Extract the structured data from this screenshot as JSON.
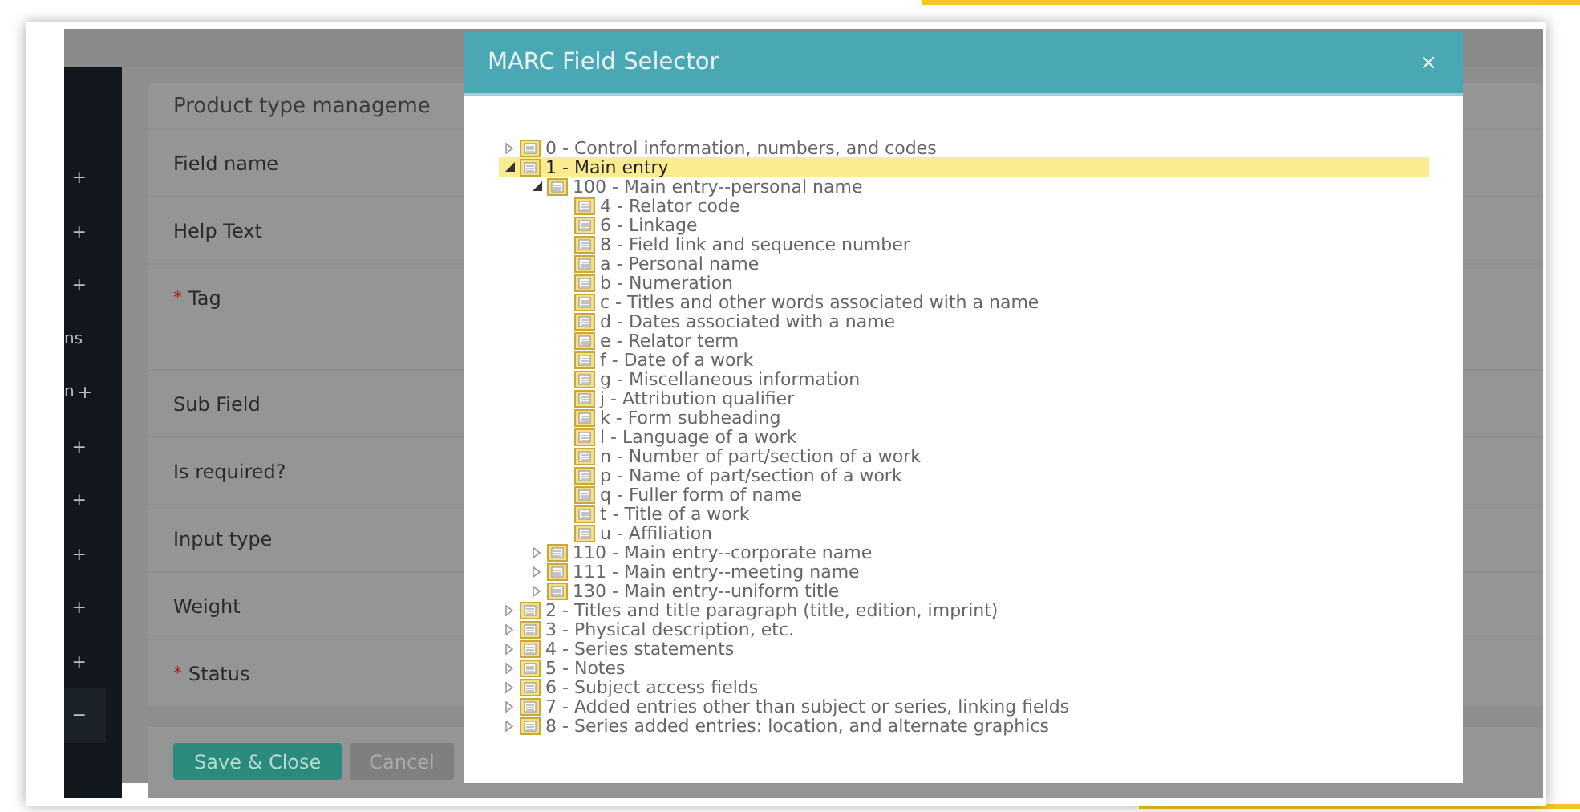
{
  "sidebar": {
    "items": [
      {
        "toggle": "+",
        "selected": false
      },
      {
        "toggle": "+",
        "selected": false
      },
      {
        "toggle": "+",
        "selected": false
      },
      {
        "label": "ns",
        "selected": false
      },
      {
        "label": "n",
        "toggle": "+",
        "selected": false
      },
      {
        "toggle": "+",
        "selected": false
      },
      {
        "toggle": "+",
        "selected": false
      },
      {
        "toggle": "+",
        "selected": false
      },
      {
        "toggle": "+",
        "selected": false
      },
      {
        "toggle": "+",
        "selected": false
      },
      {
        "toggle": "−",
        "selected": true
      }
    ]
  },
  "form": {
    "title": "Product type manageme",
    "fields": [
      {
        "label": "Field name",
        "tall": false
      },
      {
        "label": "Help Text",
        "tall": false
      },
      {
        "marker": "*",
        "label": "Tag",
        "tall": true
      },
      {
        "label": "Sub Field",
        "tall": false
      },
      {
        "label": "Is required?",
        "tall": false
      },
      {
        "label": "Input type",
        "tall": false
      },
      {
        "label": "Weight",
        "tall": false
      },
      {
        "marker": "*",
        "label": "Status",
        "tall": false
      }
    ],
    "buttons": [
      {
        "label": "Save & Close",
        "kind": "primary"
      },
      {
        "label": "Cancel",
        "kind": "secondary"
      }
    ]
  },
  "dialog": {
    "title": "MARC Field Selector",
    "close": "×",
    "tree": [
      {
        "label": "0 - Control information, numbers, and codes",
        "kind": "branch",
        "expanded": false,
        "selected": false
      },
      {
        "label": "1 - Main entry",
        "kind": "branch",
        "expanded": true,
        "selected": true,
        "children": [
          {
            "label": "100 - Main entry--personal name",
            "kind": "branch",
            "expanded": true,
            "selected": false,
            "children": [
              {
                "label": "4 - Relator code",
                "kind": "leaf",
                "selected": false
              },
              {
                "label": "6 - Linkage",
                "kind": "leaf",
                "selected": false
              },
              {
                "label": "8 - Field link and sequence number",
                "kind": "leaf",
                "selected": false
              },
              {
                "label": "a - Personal name",
                "kind": "leaf",
                "selected": false
              },
              {
                "label": "b - Numeration",
                "kind": "leaf",
                "selected": false
              },
              {
                "label": "c - Titles and other words associated with a name",
                "kind": "leaf",
                "selected": false
              },
              {
                "label": "d - Dates associated with a name",
                "kind": "leaf",
                "selected": false
              },
              {
                "label": "e - Relator term",
                "kind": "leaf",
                "selected": false
              },
              {
                "label": "f - Date of a work",
                "kind": "leaf",
                "selected": false
              },
              {
                "label": "g - Miscellaneous information",
                "kind": "leaf",
                "selected": false
              },
              {
                "label": "j - Attribution qualifier",
                "kind": "leaf",
                "selected": false
              },
              {
                "label": "k - Form subheading",
                "kind": "leaf",
                "selected": false
              },
              {
                "label": "l - Language of a work",
                "kind": "leaf",
                "selected": false
              },
              {
                "label": "n - Number of part/section of a work",
                "kind": "leaf",
                "selected": false
              },
              {
                "label": "p - Name of part/section of a work",
                "kind": "leaf",
                "selected": false
              },
              {
                "label": "q - Fuller form of name",
                "kind": "leaf",
                "selected": false
              },
              {
                "label": "t - Title of a work",
                "kind": "leaf",
                "selected": false
              },
              {
                "label": "u - Affiliation",
                "kind": "leaf",
                "selected": false
              }
            ]
          },
          {
            "label": "110 - Main entry--corporate name",
            "kind": "branch",
            "expanded": false,
            "selected": false
          },
          {
            "label": "111 - Main entry--meeting name",
            "kind": "branch",
            "expanded": false,
            "selected": false
          },
          {
            "label": "130 - Main entry--uniform title",
            "kind": "branch",
            "expanded": false,
            "selected": false
          }
        ]
      },
      {
        "label": "2 - Titles and title paragraph (title, edition, imprint)",
        "kind": "branch",
        "expanded": false,
        "selected": false
      },
      {
        "label": "3 - Physical description, etc.",
        "kind": "branch",
        "expanded": false,
        "selected": false
      },
      {
        "label": "4 - Series statements",
        "kind": "branch",
        "expanded": false,
        "selected": false
      },
      {
        "label": "5 - Notes",
        "kind": "branch",
        "expanded": false,
        "selected": false
      },
      {
        "label": "6 - Subject access fields",
        "kind": "branch",
        "expanded": false,
        "selected": false
      },
      {
        "label": "7 - Added entries other than subject or series, linking fields",
        "kind": "branch",
        "expanded": false,
        "selected": false
      },
      {
        "label": "8 - Series added entries: location, and alternate graphics",
        "kind": "branch",
        "expanded": false,
        "selected": false
      }
    ]
  }
}
